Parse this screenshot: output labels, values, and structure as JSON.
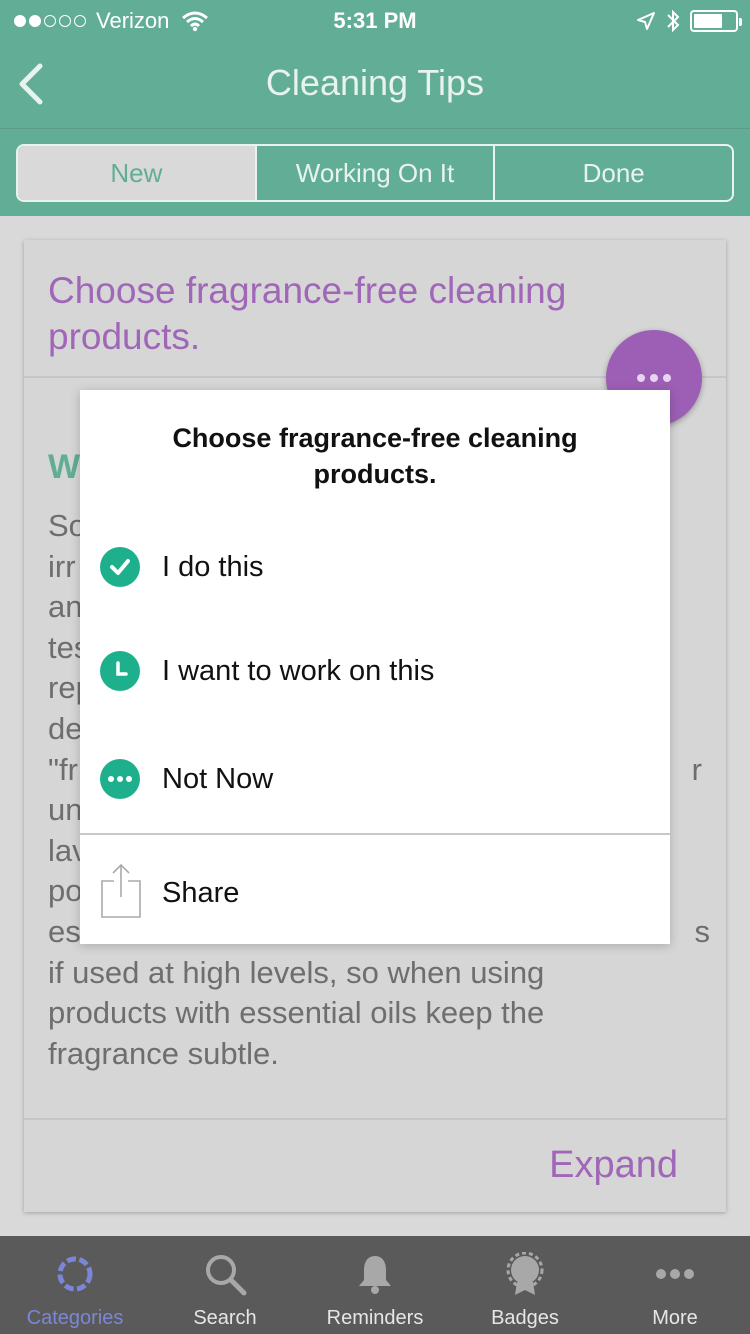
{
  "status_bar": {
    "carrier": "Verizon",
    "time": "5:31 PM",
    "signal_bars_filled": 2,
    "signal_bars_total": 5
  },
  "header": {
    "title": "Cleaning Tips",
    "back_icon": "chevron-left-icon"
  },
  "segments": [
    {
      "label": "New",
      "selected": true
    },
    {
      "label": "Working On It",
      "selected": false
    },
    {
      "label": "Done",
      "selected": false
    }
  ],
  "card": {
    "title": "Choose fragrance-free cleaning products.",
    "subtitle_visible": "W",
    "body_lines": [
      "So",
      "irr",
      "an",
      "tes",
      "rep",
      "de",
      "\"fr",
      "un",
      "lav",
      "po",
      "es",
      "if used at high levels, so when using",
      "products with essential oils keep the",
      "fragrance subtle."
    ],
    "body_right_fragments": {
      "line7": "r",
      "line11": "s"
    },
    "expand_label": "Expand"
  },
  "modal": {
    "title": "Choose fragrance-free cleaning products.",
    "options": [
      {
        "label": "I do this",
        "icon": "check-circle-icon"
      },
      {
        "label": "I want to work on this",
        "icon": "clock-icon"
      },
      {
        "label": "Not Now",
        "icon": "more-circle-icon"
      }
    ],
    "share_label": "Share"
  },
  "tabbar": [
    {
      "label": "Categories",
      "icon": "categories-ring-icon",
      "active": true
    },
    {
      "label": "Search",
      "icon": "search-icon",
      "active": false
    },
    {
      "label": "Reminders",
      "icon": "bell-icon",
      "active": false
    },
    {
      "label": "Badges",
      "icon": "badge-icon",
      "active": false
    },
    {
      "label": "More",
      "icon": "more-dots-icon",
      "active": false
    }
  ],
  "colors": {
    "header_green": "#62ad96",
    "accent_purple": "#a066b8",
    "option_green": "#1eb08c",
    "tab_active": "#7b87d6"
  }
}
